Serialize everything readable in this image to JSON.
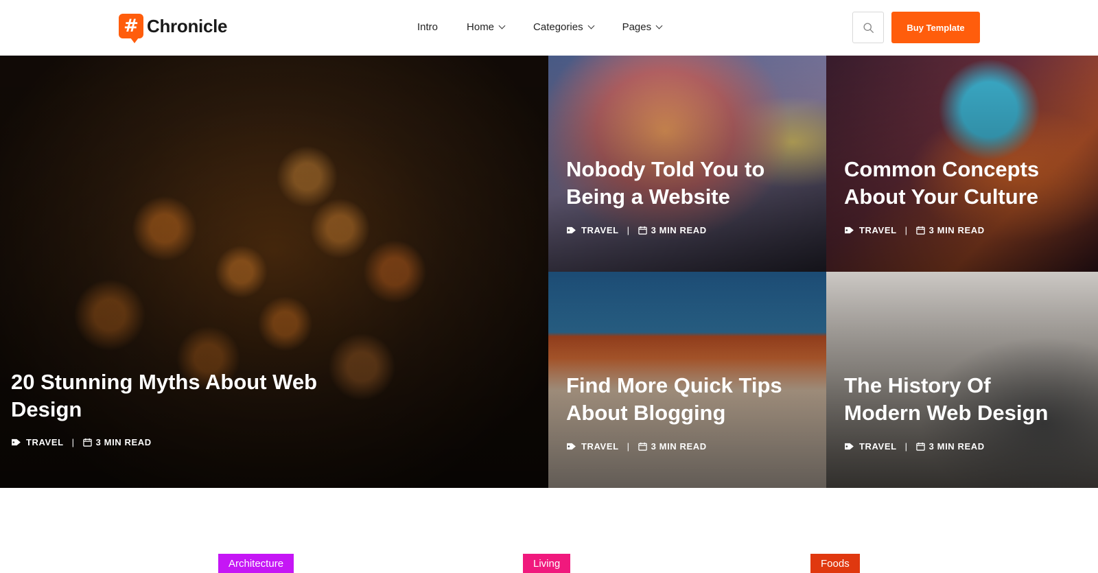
{
  "brand": {
    "name": "Chronicle",
    "mark": "#",
    "accent": "#ff5d0c"
  },
  "nav": {
    "items": [
      {
        "label": "Intro",
        "dropdown": false
      },
      {
        "label": "Home",
        "dropdown": true
      },
      {
        "label": "Categories",
        "dropdown": true
      },
      {
        "label": "Pages",
        "dropdown": true
      }
    ]
  },
  "header": {
    "search_icon": "search-icon",
    "buy_label": "Buy Template"
  },
  "posts": [
    {
      "title": "20 Stunning Myths About Web Design",
      "category": "TRAVEL",
      "read_time": "3 MIN READ"
    },
    {
      "title": "Nobody Told You to Being a Website",
      "category": "TRAVEL",
      "read_time": "3 MIN READ"
    },
    {
      "title": "Common Concepts About Your Culture",
      "category": "TRAVEL",
      "read_time": "3 MIN READ"
    },
    {
      "title": "Find More Quick Tips About Blogging",
      "category": "TRAVEL",
      "read_time": "3 MIN READ"
    },
    {
      "title": "The History Of Modern Web Design",
      "category": "TRAVEL",
      "read_time": "3 MIN READ"
    }
  ],
  "category_tags": [
    {
      "label": "Architecture",
      "color": "#c516f5"
    },
    {
      "label": "Living",
      "color": "#f0197d"
    },
    {
      "label": "Foods",
      "color": "#e0380f"
    }
  ],
  "separator": "|"
}
